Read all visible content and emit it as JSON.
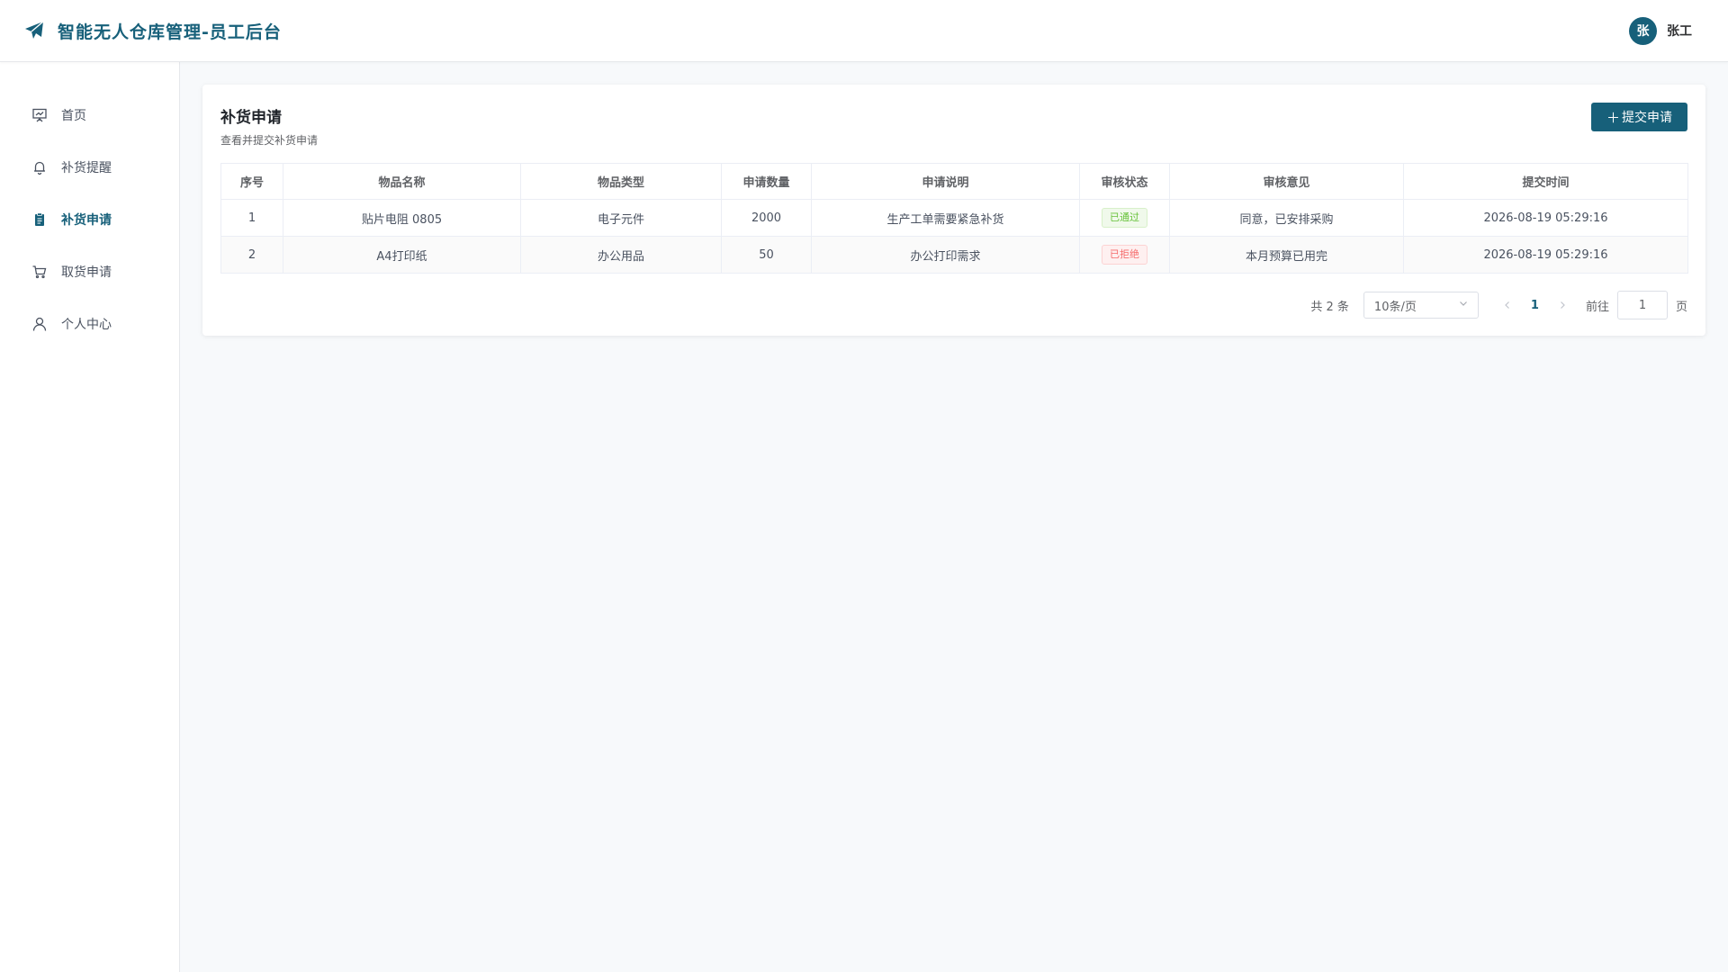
{
  "header": {
    "title": "智能无人仓库管理-员工后台",
    "user": {
      "avatar_text": "张",
      "name": "张工"
    }
  },
  "sidebar": {
    "items": [
      {
        "label": "首页",
        "icon": "presentation-icon"
      },
      {
        "label": "补货提醒",
        "icon": "bell-icon"
      },
      {
        "label": "补货申请",
        "icon": "clipboard-icon",
        "active": true
      },
      {
        "label": "取货申请",
        "icon": "cart-icon"
      },
      {
        "label": "个人中心",
        "icon": "user-icon"
      }
    ]
  },
  "main": {
    "title": "补货申请",
    "subtitle": "查看并提交补货申请",
    "submit_label": "提交申请",
    "table": {
      "columns": [
        "序号",
        "物品名称",
        "物品类型",
        "申请数量",
        "申请说明",
        "审核状态",
        "审核意见",
        "提交时间"
      ],
      "rows": [
        {
          "no": "1",
          "name": "贴片电阻 0805",
          "type": "电子元件",
          "qty": "2000",
          "desc": "生产工单需要紧急补货",
          "status": "已通过",
          "opinion": "同意，已安排采购",
          "time": "2026-08-19 05:29:16"
        },
        {
          "no": "2",
          "name": "A4打印纸",
          "type": "办公用品",
          "qty": "50",
          "desc": "办公打印需求",
          "status": "已拒绝",
          "opinion": "本月预算已用完",
          "time": "2026-08-19 05:29:16"
        }
      ]
    },
    "pagination": {
      "total_text": "共 2 条",
      "page_size": "10条/页",
      "current_page": "1",
      "jump_label": "前往",
      "jump_value": "1",
      "page_suffix": "页"
    }
  },
  "colors": {
    "accent": "#17607a",
    "success": "#67c23a",
    "danger": "#f56c6c"
  }
}
